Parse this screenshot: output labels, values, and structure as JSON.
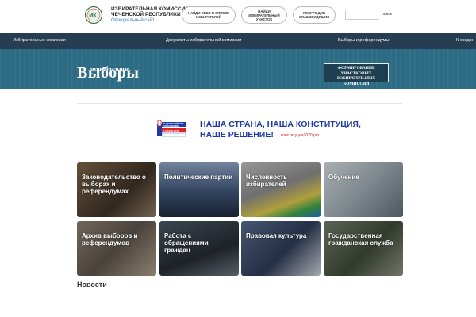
{
  "header": {
    "org_name_line1": "ИЗБИРАТЕЛЬНАЯ КОМИССИЯ",
    "org_name_line2": "ЧЕЧЕНСКОЙ РЕСПУБЛИКИ",
    "org_sub": "Официальный сайт",
    "buttons": [
      {
        "line1": "НАЙДИ СЕБЯ В СПИСКЕ",
        "line2": "ИЗБИРАТЕЛЕЙ"
      },
      {
        "line1": "НАЙДИ",
        "line2": "ИЗБИРАТЕЛЬНЫЙ",
        "line3": "УЧАСТОК"
      },
      {
        "line1": "РЕСУРС ДЛЯ",
        "line2": "СЛАБОВИДЯЩИХ"
      }
    ],
    "search_label": "поиск"
  },
  "nav": {
    "items": [
      "Избирательные комиссии",
      "Документы избирательной комиссии",
      "Выборы и референдумы",
      "К сведен"
    ]
  },
  "banner": {
    "title": "Выборы",
    "title_prefix": "муниципальные",
    "button_line1": "ФОРМИРОВАНИЕ",
    "button_line2": "УЧАСТКОВЫХ ИЗБИРАТЕЛЬНЫХ",
    "button_line3": "КОМИССИЙ"
  },
  "constitution": {
    "line1": "НАША СТРАНА, НАША КОНСТИТУЦИЯ,",
    "line2": "НАШЕ РЕШЕНИЕ!",
    "site": "конституция2020.рф",
    "icon_text1": "ОБЩЕРОССИЙСКОЕ",
    "icon_text2": "ГОЛОСОВАНИЕ",
    "icon_date": "1 ИЮЛЯ 2020"
  },
  "tiles": [
    {
      "label": "Законодательство о выборах и референдумах",
      "color": "#5a4a3a"
    },
    {
      "label": "Политические партии",
      "color": "#3d5470"
    },
    {
      "label": "Численность избирателей",
      "color": "#7b7b7b"
    },
    {
      "label": "Обучение",
      "color": "#9aa6ad"
    },
    {
      "label": "Архив выборов и референдумов",
      "color": "#6b6156"
    },
    {
      "label": "Работа с обращениями граждан",
      "color": "#2f3842"
    },
    {
      "label": "Правовая культура",
      "color": "#3b4c68"
    },
    {
      "label": "Государственная гражданская служба",
      "color": "#4e5a4c"
    }
  ],
  "news": {
    "title": "Новости"
  },
  "colors": {
    "nav_bg": "#263d52",
    "banner_bg": "#2c6b84",
    "const_blue": "#1e3aa6",
    "link_blue": "#3a7bbf"
  }
}
